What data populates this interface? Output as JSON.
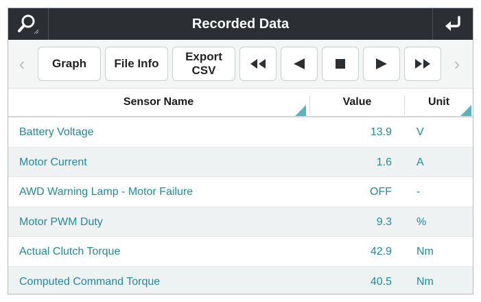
{
  "window": {
    "title": "Recorded Data",
    "left_icon": "search-icon",
    "right_icon": "back-arrow-icon"
  },
  "toolbar": {
    "prev_label": "‹",
    "next_label": "›",
    "graph_label": "Graph",
    "file_info_label": "File Info",
    "export_line1": "Export",
    "export_line2": "CSV",
    "rewind_icon": "rewind-icon",
    "step_back_icon": "step-back-icon",
    "stop_icon": "stop-icon",
    "play_icon": "play-icon",
    "fast_forward_icon": "fast-forward-icon"
  },
  "table": {
    "headers": {
      "name": "Sensor Name",
      "value": "Value",
      "unit": "Unit"
    },
    "rows": [
      {
        "name": "Battery Voltage",
        "value": "13.9",
        "unit": "V"
      },
      {
        "name": "Motor Current",
        "value": "1.6",
        "unit": "A"
      },
      {
        "name": "AWD Warning Lamp - Motor Failure",
        "value": "OFF",
        "unit": "-"
      },
      {
        "name": "Motor PWM Duty",
        "value": "9.3",
        "unit": "%"
      },
      {
        "name": "Actual Clutch Torque",
        "value": "42.9",
        "unit": "Nm"
      },
      {
        "name": "Computed Command Torque",
        "value": "40.5",
        "unit": "Nm"
      }
    ]
  },
  "colors": {
    "titlebar": "#2b2f33",
    "accent": "#1f8aa0",
    "sort_indicator": "#5fb0bd",
    "alt_row": "#eef2f2"
  }
}
